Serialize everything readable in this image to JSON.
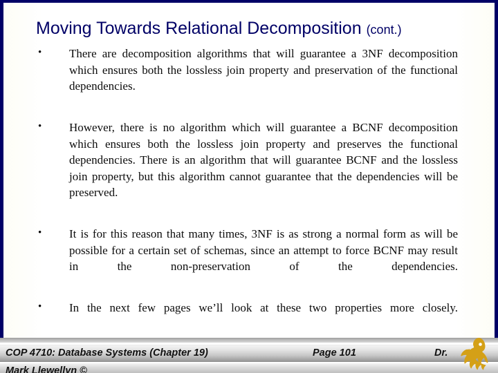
{
  "slide": {
    "title_main": "Moving Towards Relational Decomposition ",
    "title_cont": "(cont.)",
    "bullet_marker": "•",
    "bullets": [
      {
        "marker": "•",
        "text": "There are decomposition algorithms that will guarantee a 3NF decomposition which ensures both the lossless join property and preservation of the functional dependencies."
      },
      {
        "marker": "•",
        "text": "However, there is no algorithm which will guarantee a BCNF decomposition which ensures both the lossless join property and preserves the functional dependencies.  There is an algorithm that will guarantee BCNF and the lossless join property, but this algorithm cannot guarantee that the dependencies will be preserved."
      },
      {
        "marker": "•",
        "text": "It is for this reason that many times, 3NF is as strong a normal form as will be possible for a certain set of schemas, since an attempt to force BCNF may result in the non-preservation of the dependencies."
      },
      {
        "marker": "•",
        "text": "In the next few pages we’ll look at these two properties more closely."
      }
    ]
  },
  "footer": {
    "course": "COP 4710: Database Systems  (Chapter 19)",
    "page": "Page 101",
    "author_prefix": "Dr.",
    "author_line2": "Mark Llewellyn ©",
    "logo_name": "ucf-pegasus-logo"
  },
  "colors": {
    "frame_navy": "#000066",
    "title_navy": "#000066",
    "body_text": "#0c0c0c",
    "logo_gold": "#d4a017",
    "footer_bar_light": "#f4f4f4",
    "footer_bar_dark": "#8f8f8f",
    "background": "#fefefe"
  }
}
